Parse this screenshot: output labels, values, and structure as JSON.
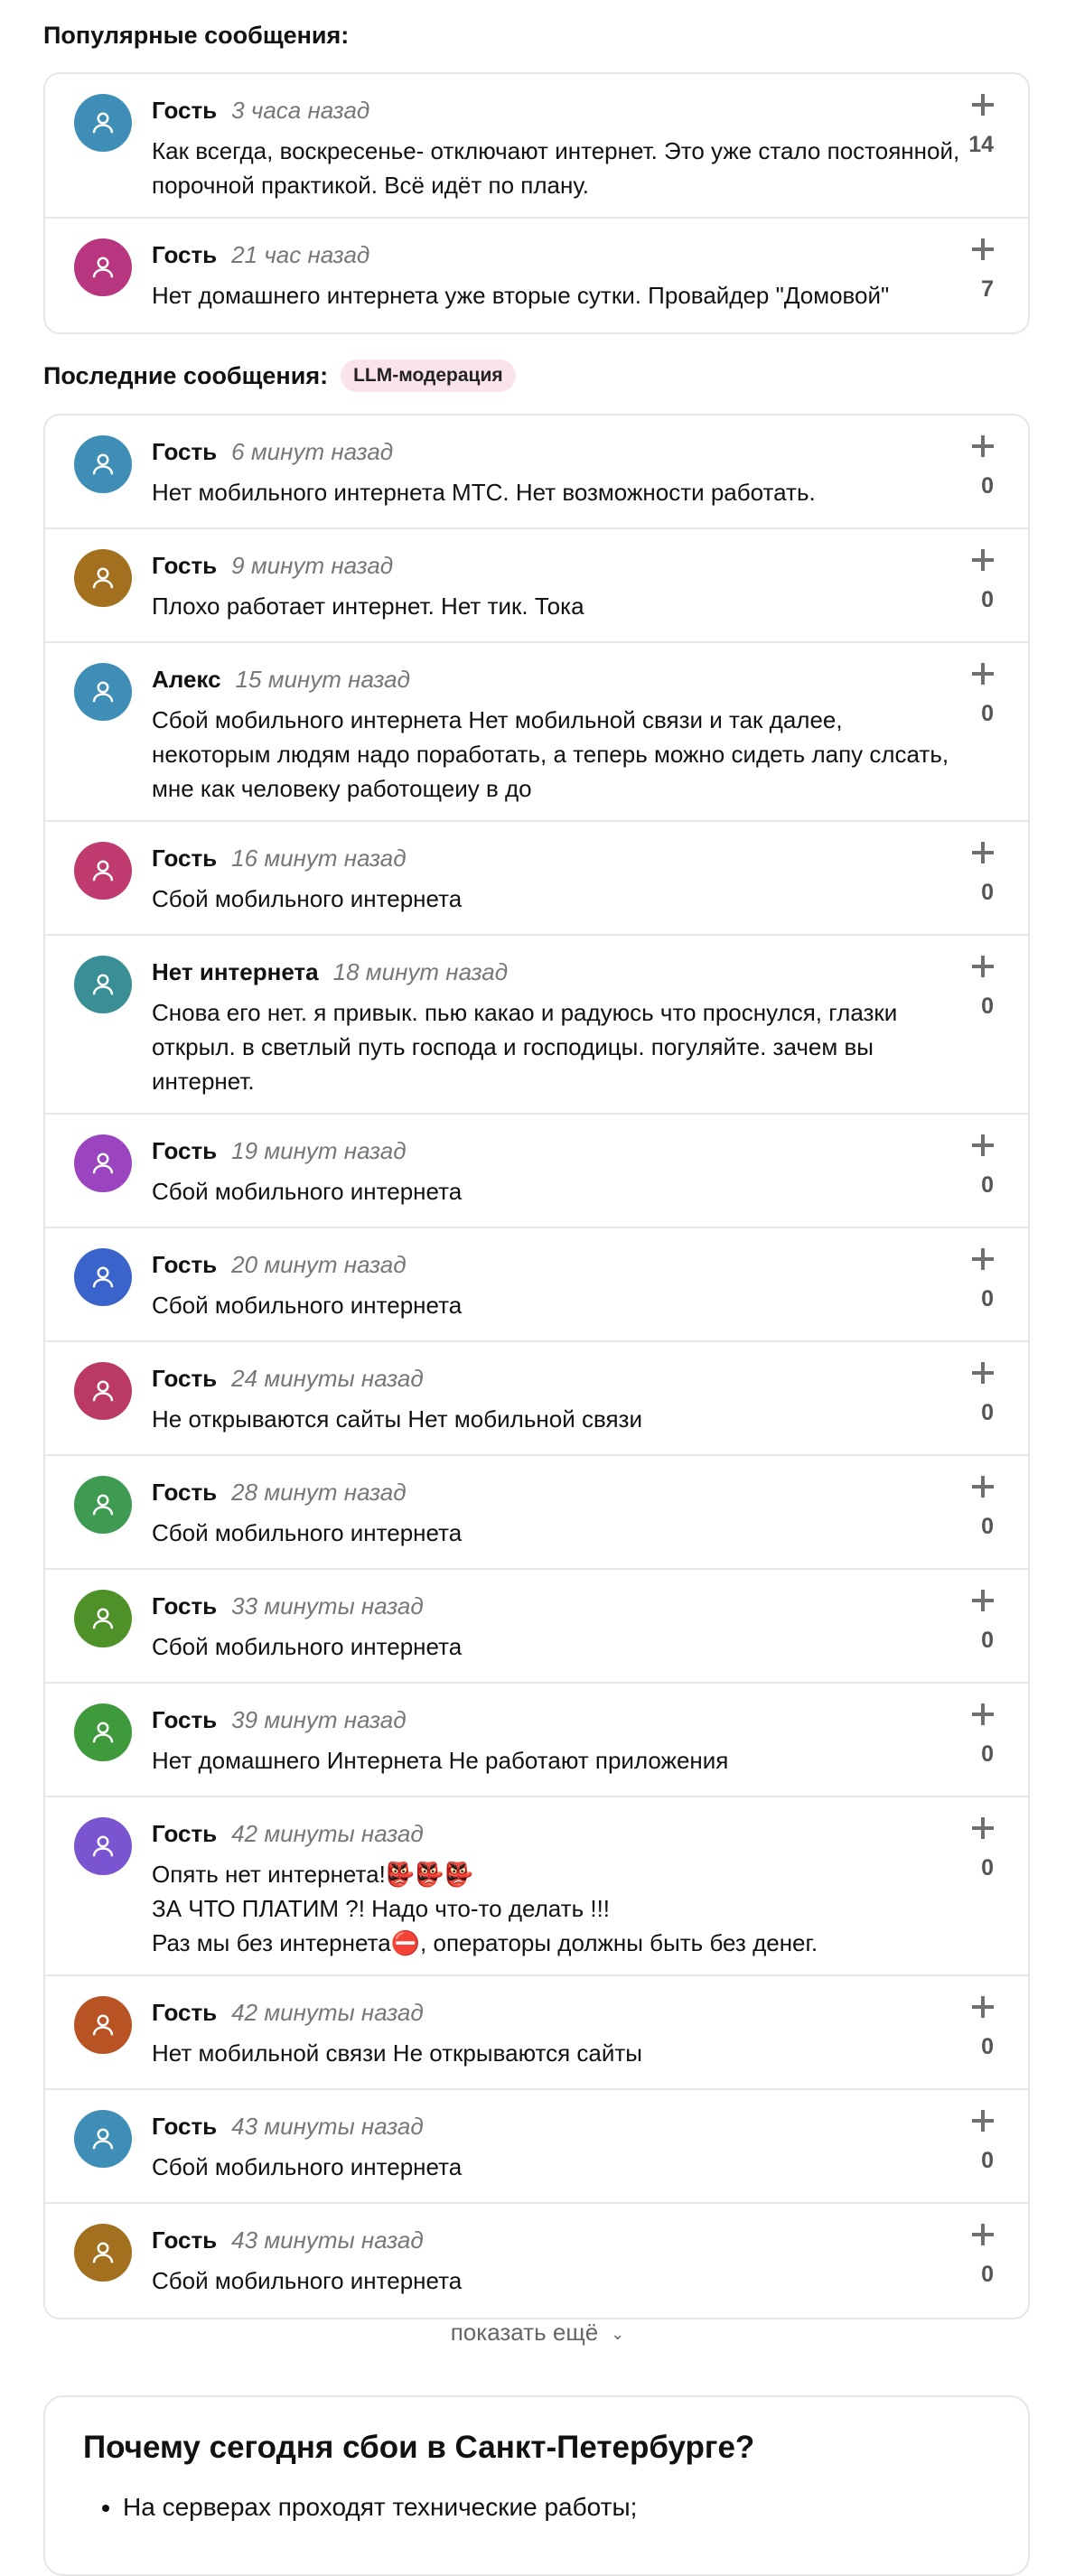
{
  "popular": {
    "title": "Популярные сообщения:",
    "items": [
      {
        "author": "Гость",
        "time": "3 часа назад",
        "text": "Как всегда, воскресенье- отключают интернет. Это уже стало постоянной, порочной практикой. Всё идёт по плану.",
        "count": "14",
        "color": "#3e8eb7"
      },
      {
        "author": "Гость",
        "time": "21 час назад",
        "text": "Нет домашнего интернета уже вторые сутки. Провайдер \"Домовой\"",
        "count": "7",
        "color": "#b8367f"
      }
    ]
  },
  "latest": {
    "title": "Последние сообщения:",
    "badge": "LLM-модерация",
    "items": [
      {
        "author": "Гость",
        "time": "6 минут назад",
        "text": "Нет мобильного интернета МТС. Нет возможности работать.",
        "count": "0",
        "color": "#3e8eb7"
      },
      {
        "author": "Гость",
        "time": "9 минут назад",
        "text": "Плохо работает интернет. Нет тик. Тока",
        "count": "0",
        "color": "#a2701e"
      },
      {
        "author": "Алекс",
        "time": "15 минут назад",
        "text": "Сбой мобильного интернета Нет мобильной связи и так далее, некоторым людям надо поработать, а теперь можно сидеть лапу слсать, мне как человеку работощеиу в до",
        "count": "0",
        "color": "#3e8eb7"
      },
      {
        "author": "Гость",
        "time": "16 минут назад",
        "text": "Сбой мобильного интернета",
        "count": "0",
        "color": "#bf3a6f"
      },
      {
        "author": "Нет интернета",
        "time": "18 минут назад",
        "text": "Снова его нет. я привык. пью какао и радуюсь что проснулся, глазки открыл. в светлый путь господа и господицы. погуляйте. зачем вы интернет.",
        "count": "0",
        "color": "#3a8f97"
      },
      {
        "author": "Гость",
        "time": "19 минут назад",
        "text": "Сбой мобильного интернета",
        "count": "0",
        "color": "#9a44c0"
      },
      {
        "author": "Гость",
        "time": "20 минут назад",
        "text": "Сбой мобильного интернета",
        "count": "0",
        "color": "#3b63cc"
      },
      {
        "author": "Гость",
        "time": "24 минуты назад",
        "text": "Не открываются сайты Нет мобильной связи",
        "count": "0",
        "color": "#bb3a63"
      },
      {
        "author": "Гость",
        "time": "28 минут назад",
        "text": "Сбой мобильного интернета",
        "count": "0",
        "color": "#3f9a52"
      },
      {
        "author": "Гость",
        "time": "33 минуты назад",
        "text": "Сбой мобильного интернета",
        "count": "0",
        "color": "#4e9128"
      },
      {
        "author": "Гость",
        "time": "39 минут назад",
        "text": "Нет домашнего Интернета Не работают приложения",
        "count": "0",
        "color": "#3f9a3c"
      },
      {
        "author": "Гость",
        "time": "42 минуты назад",
        "lines": [
          "Опять нет интернета!",
          "ЗА ЧТО ПЛАТИМ ?! Надо что-то делать !!!",
          "Раз мы без интернета",
          ", операторы должны быть без денег."
        ],
        "emoji": "👺👺👺",
        "stop": "⛔",
        "count": "0",
        "color": "#7a54d1"
      },
      {
        "author": "Гость",
        "time": "42 минуты назад",
        "text": "Нет мобильной связи Не открываются сайты",
        "count": "0",
        "color": "#b85424"
      },
      {
        "author": "Гость",
        "time": "43 минуты назад",
        "text": "Сбой мобильного интернета",
        "count": "0",
        "color": "#3e8eb7"
      },
      {
        "author": "Гость",
        "time": "43 минуты назад",
        "text": "Сбой мобильного интернета",
        "count": "0",
        "color": "#a2701e"
      }
    ]
  },
  "show_more": {
    "label": "показать ещё",
    "icon": "chevron-down-icon"
  },
  "why": {
    "title": "Почему сегодня сбои в Санкт-Петербурге?",
    "first_item": "На серверах проходят технические работы;"
  },
  "icons": {
    "avatar": "user-icon",
    "upvote": "plus-icon"
  }
}
